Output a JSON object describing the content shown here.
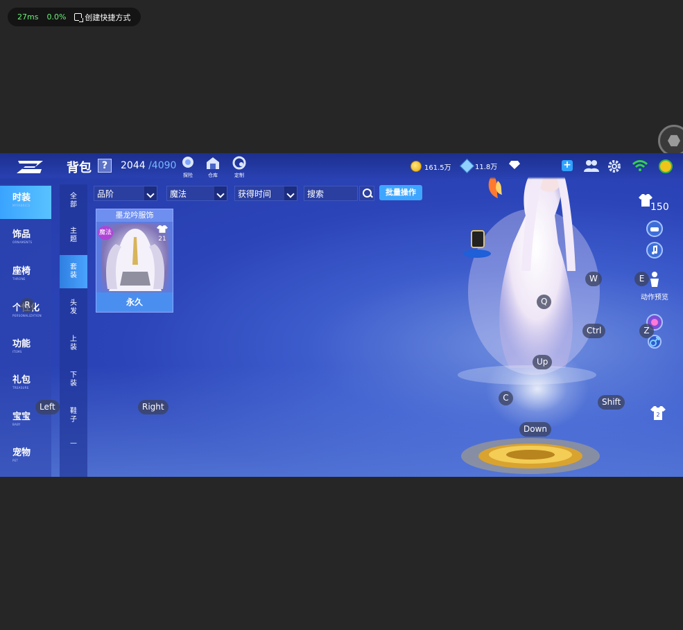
{
  "overlay": {
    "latency": "27ms",
    "packet_loss": "0.0%",
    "shortcut_label": "创建快捷方式",
    "float_ball_icon": "hexagon-icon"
  },
  "topbar": {
    "title": "背包",
    "help_label": "?",
    "capacity_used": "2044",
    "capacity_max": "/4090",
    "icons": [
      {
        "name": "explore-icon",
        "label": "探险"
      },
      {
        "name": "warehouse-icon",
        "label": "仓库"
      },
      {
        "name": "customize-icon",
        "label": "定制"
      }
    ],
    "gold": "161.5万",
    "tickets": "11.8万",
    "diamond_icon": "diamond-icon"
  },
  "leftnav": {
    "items": [
      {
        "zh": "时装",
        "en": "MYFABRICS",
        "active": true
      },
      {
        "zh": "饰品",
        "en": "ORNAMENTS"
      },
      {
        "zh": "座椅",
        "en": "THRONE"
      },
      {
        "zh": "个性化",
        "en": "PERSONALIZATION"
      },
      {
        "zh": "功能",
        "en": "ITEMS"
      },
      {
        "zh": "礼包",
        "en": "TREASURE"
      },
      {
        "zh": "宝宝",
        "en": "BABY"
      },
      {
        "zh": "宠物",
        "en": "PET"
      }
    ]
  },
  "subnav": {
    "items": [
      {
        "label": "全部"
      },
      {
        "label": "主题"
      },
      {
        "label": "套装",
        "active": true
      },
      {
        "label": "头发"
      },
      {
        "label": "上装"
      },
      {
        "label": "下装"
      },
      {
        "label": "鞋子"
      },
      {
        "label": "—"
      }
    ]
  },
  "filters": {
    "quality": "品阶",
    "type": "魔法",
    "sort": "获得时间",
    "search_placeholder": "搜索",
    "batch_label": "批量操作"
  },
  "card": {
    "name": "墨龙吟服饰",
    "tag": "魔法",
    "count": "21",
    "duration": "永久"
  },
  "right": {
    "wardrobe_count": "150",
    "action_preview": "动作预览"
  },
  "keys": [
    "R",
    "Left",
    "Right",
    "W",
    "E",
    "Q",
    "Ctrl",
    "Z",
    "Up",
    "C",
    "Shift",
    "Down"
  ],
  "colors": {
    "accent": "#3ea6ff",
    "game_bg": "#2b44b8",
    "latency_green": "#6cf07a"
  }
}
